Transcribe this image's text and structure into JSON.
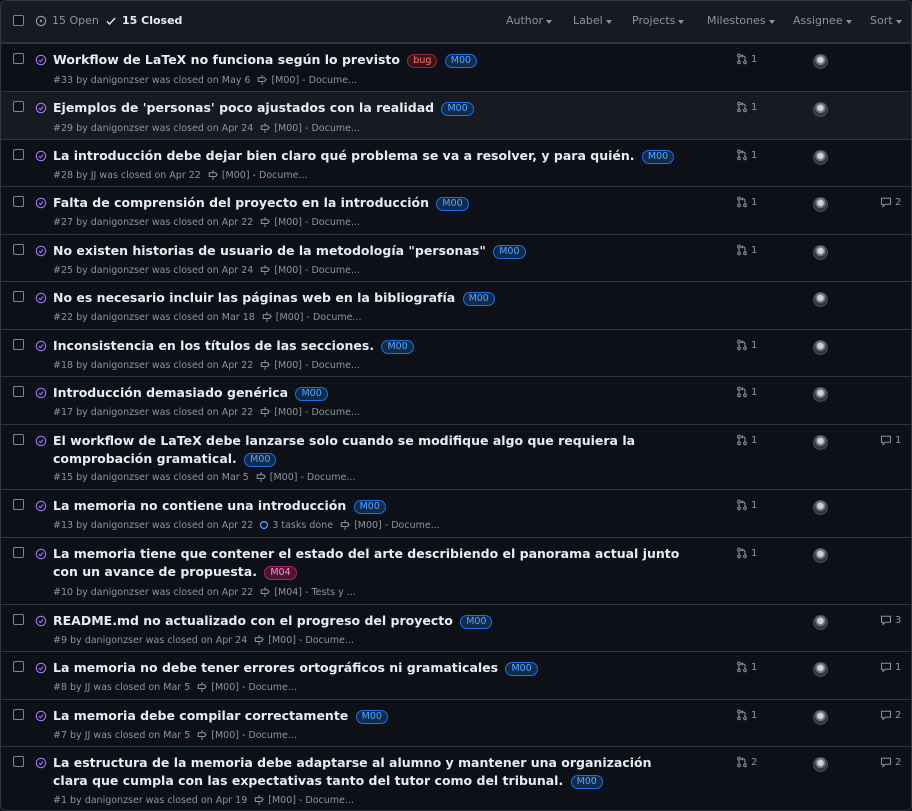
{
  "header": {
    "open_label": "15 Open",
    "closed_label": "15 Closed",
    "filters": [
      "Author",
      "Label",
      "Projects",
      "Milestones",
      "Assignee",
      "Sort"
    ]
  },
  "colors": {
    "bg": "#0d1117",
    "header_bg": "#161b22",
    "border": "#30363d",
    "closed_purple": "#a371f7",
    "muted": "#8b949e",
    "label_blue": "#58a6ff",
    "label_bug": "#ff7b72"
  },
  "icons": {
    "closed": "issue-closed-icon",
    "pr": "pull-request-icon",
    "milestone": "milestone-icon",
    "comment": "comment-icon",
    "task": "task-progress-icon",
    "check": "check-icon",
    "open": "issue-open-icon"
  },
  "issues": [
    {
      "title": "Workflow de LaTeX no funciona según lo previsto",
      "labels": [
        {
          "text": "bug",
          "kind": "bug"
        },
        {
          "text": "M00",
          "kind": "m"
        }
      ],
      "meta": "#33 by danigonzser was closed on May 6",
      "milestone": "[M00] - Docume...",
      "tasks": "",
      "prs": "1",
      "comments": ""
    },
    {
      "title": "Ejemplos de 'personas' poco ajustados con la realidad",
      "labels": [
        {
          "text": "M00",
          "kind": "m"
        }
      ],
      "meta": "#29 by danigonzser was closed on Apr 24",
      "milestone": "[M00] - Docume...",
      "tasks": "",
      "prs": "1",
      "comments": ""
    },
    {
      "title": "La introducción debe dejar bien claro qué problema se va a resolver, y para quién.",
      "labels": [
        {
          "text": "M00",
          "kind": "m"
        }
      ],
      "meta": "#28 by JJ was closed on Apr 22",
      "milestone": "[M00] - Docume...",
      "tasks": "",
      "prs": "1",
      "comments": ""
    },
    {
      "title": "Falta de comprensión del proyecto en la introducción",
      "labels": [
        {
          "text": "M00",
          "kind": "m"
        }
      ],
      "meta": "#27 by danigonzser was closed on Apr 22",
      "milestone": "[M00] - Docume...",
      "tasks": "",
      "prs": "1",
      "comments": "2"
    },
    {
      "title": "No existen historias de usuario de la metodología \"personas\"",
      "labels": [
        {
          "text": "M00",
          "kind": "m"
        }
      ],
      "meta": "#25 by danigonzser was closed on Apr 24",
      "milestone": "[M00] - Docume...",
      "tasks": "",
      "prs": "1",
      "comments": ""
    },
    {
      "title": "No es necesario incluir las páginas web en la bibliografía",
      "labels": [
        {
          "text": "M00",
          "kind": "m"
        }
      ],
      "meta": "#22 by danigonzser was closed on Mar 18",
      "milestone": "[M00] - Docume...",
      "tasks": "",
      "prs": "",
      "comments": ""
    },
    {
      "title": "Inconsistencia en los títulos de las secciones.",
      "labels": [
        {
          "text": "M00",
          "kind": "m"
        }
      ],
      "meta": "#18 by danigonzser was closed on Apr 22",
      "milestone": "[M00] - Docume...",
      "tasks": "",
      "prs": "1",
      "comments": ""
    },
    {
      "title": "Introducción demasiado genérica",
      "labels": [
        {
          "text": "M00",
          "kind": "m"
        }
      ],
      "meta": "#17 by danigonzser was closed on Apr 22",
      "milestone": "[M00] - Docume...",
      "tasks": "",
      "prs": "1",
      "comments": ""
    },
    {
      "title": "El workflow de LaTeX debe lanzarse solo cuando se modifique algo que requiera la comprobación gramatical.",
      "labels": [
        {
          "text": "M00",
          "kind": "m"
        }
      ],
      "meta": "#15 by danigonzser was closed on Mar 5",
      "milestone": "[M00] - Docume...",
      "tasks": "",
      "prs": "1",
      "comments": "1"
    },
    {
      "title": "La memoria no contiene una introducción",
      "labels": [
        {
          "text": "M00",
          "kind": "m"
        }
      ],
      "meta": "#13 by danigonzser was closed on Apr 22",
      "milestone": "[M00] - Docume...",
      "tasks": "3 tasks done",
      "prs": "1",
      "comments": ""
    },
    {
      "title": "La memoria tiene que contener el estado del arte describiendo el panorama actual junto con un avance de propuesta.",
      "labels": [
        {
          "text": "M04",
          "kind": "m4"
        }
      ],
      "meta": "#10 by danigonzser was closed on Apr 22",
      "milestone": "[M04] - Tests y ...",
      "tasks": "",
      "prs": "1",
      "comments": ""
    },
    {
      "title": "README.md no actualizado con el progreso del proyecto",
      "labels": [
        {
          "text": "M00",
          "kind": "m"
        }
      ],
      "meta": "#9 by danigonzser was closed on Apr 24",
      "milestone": "[M00] - Docume...",
      "tasks": "",
      "prs": "",
      "comments": "3"
    },
    {
      "title": "La memoria no debe tener errores ortográficos ni gramaticales",
      "labels": [
        {
          "text": "M00",
          "kind": "m"
        }
      ],
      "meta": "#8 by JJ was closed on Mar 5",
      "milestone": "[M00] - Docume...",
      "tasks": "",
      "prs": "1",
      "comments": "1"
    },
    {
      "title": "La memoria debe compilar correctamente",
      "labels": [
        {
          "text": "M00",
          "kind": "m"
        }
      ],
      "meta": "#7 by JJ was closed on Mar 5",
      "milestone": "[M00] - Docume...",
      "tasks": "",
      "prs": "1",
      "comments": "2"
    },
    {
      "title": "La estructura de la memoria debe adaptarse al alumno y mantener una organización clara que cumpla con las expectativas tanto del tutor como del tribunal.",
      "labels": [
        {
          "text": "M00",
          "kind": "m"
        }
      ],
      "meta": "#1 by danigonzser was closed on Apr 19",
      "milestone": "[M00] - Docume...",
      "tasks": "",
      "prs": "2",
      "comments": "2"
    }
  ]
}
